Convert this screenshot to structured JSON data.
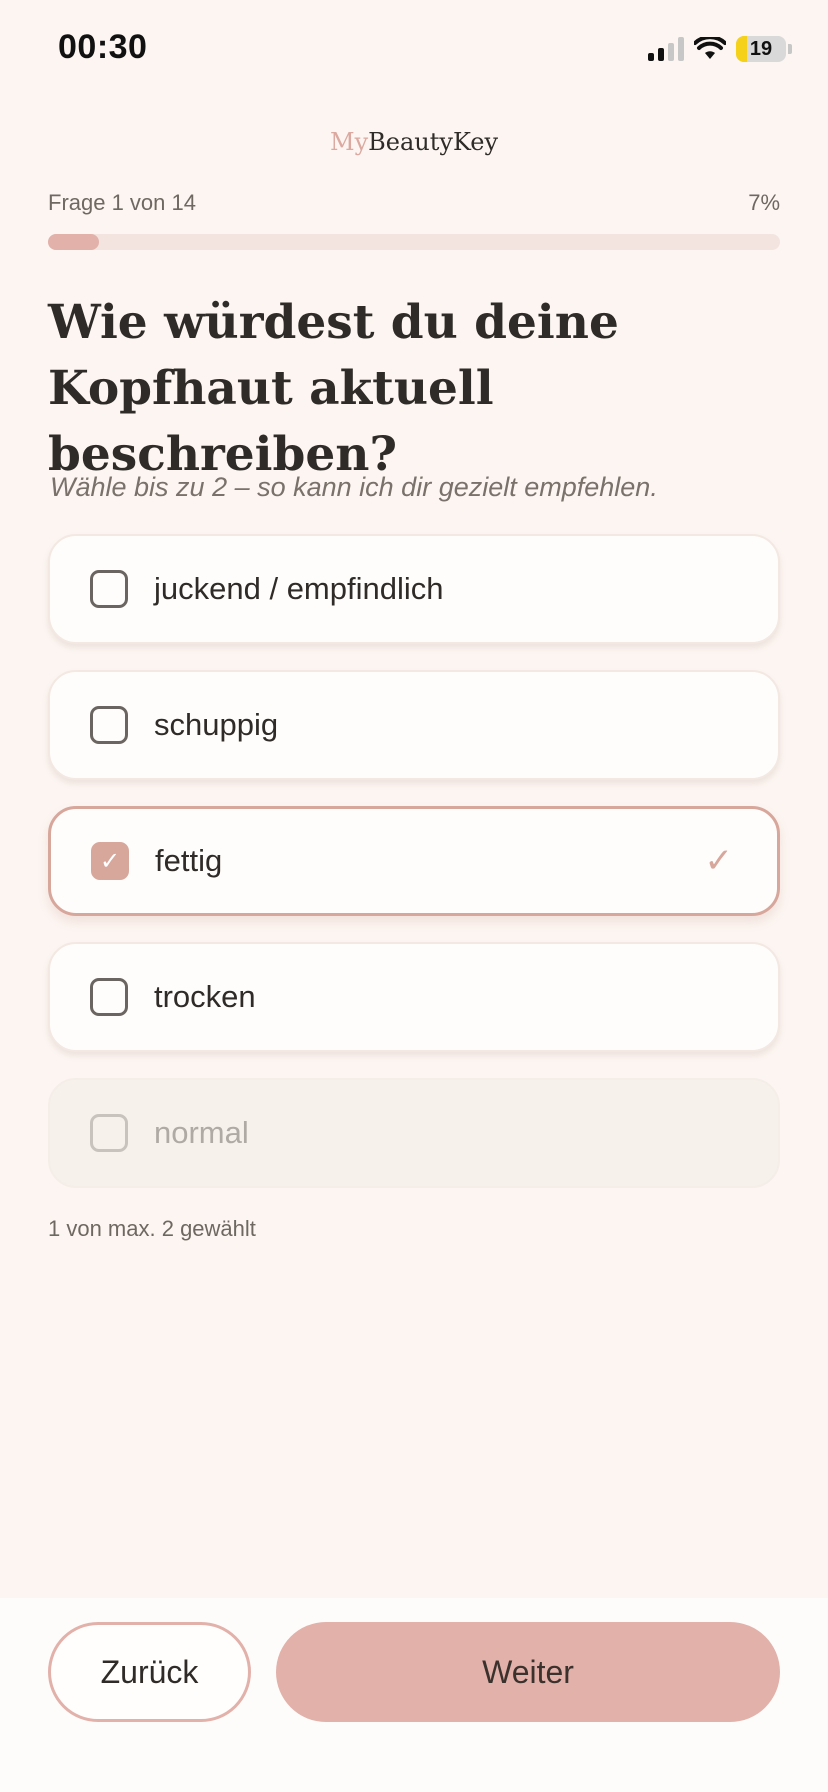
{
  "status_bar": {
    "time": "00:30",
    "battery": "19"
  },
  "brand": {
    "prefix": "My",
    "name": "BeautyKey"
  },
  "progress": {
    "label": "Frage 1 von 14",
    "percent_text": "7%",
    "value": 0.07
  },
  "question": {
    "title": "Wie würdest du deine Kopfhaut aktuell beschreiben?",
    "hint": "Wähle bis zu 2 – so kann ich dir gezielt empfehlen."
  },
  "options": [
    {
      "label": "juckend / empfindlich",
      "state": "unchecked"
    },
    {
      "label": "schuppig",
      "state": "unchecked"
    },
    {
      "label": "fettig",
      "state": "checked"
    },
    {
      "label": "trocken",
      "state": "unchecked"
    },
    {
      "label": "normal",
      "state": "disabled"
    }
  ],
  "selection_count": "1 von max. 2 gewählt",
  "footer": {
    "back_label": "Zurück",
    "next_label": "Weiter"
  },
  "colors": {
    "accent": "#e2b1aa",
    "accent_dark": "#d7a79c",
    "background": "#fcf5f1"
  },
  "icons": {
    "check": "check-icon",
    "wifi": "wifi-icon",
    "signal": "signal-icon",
    "battery": "battery-icon"
  }
}
